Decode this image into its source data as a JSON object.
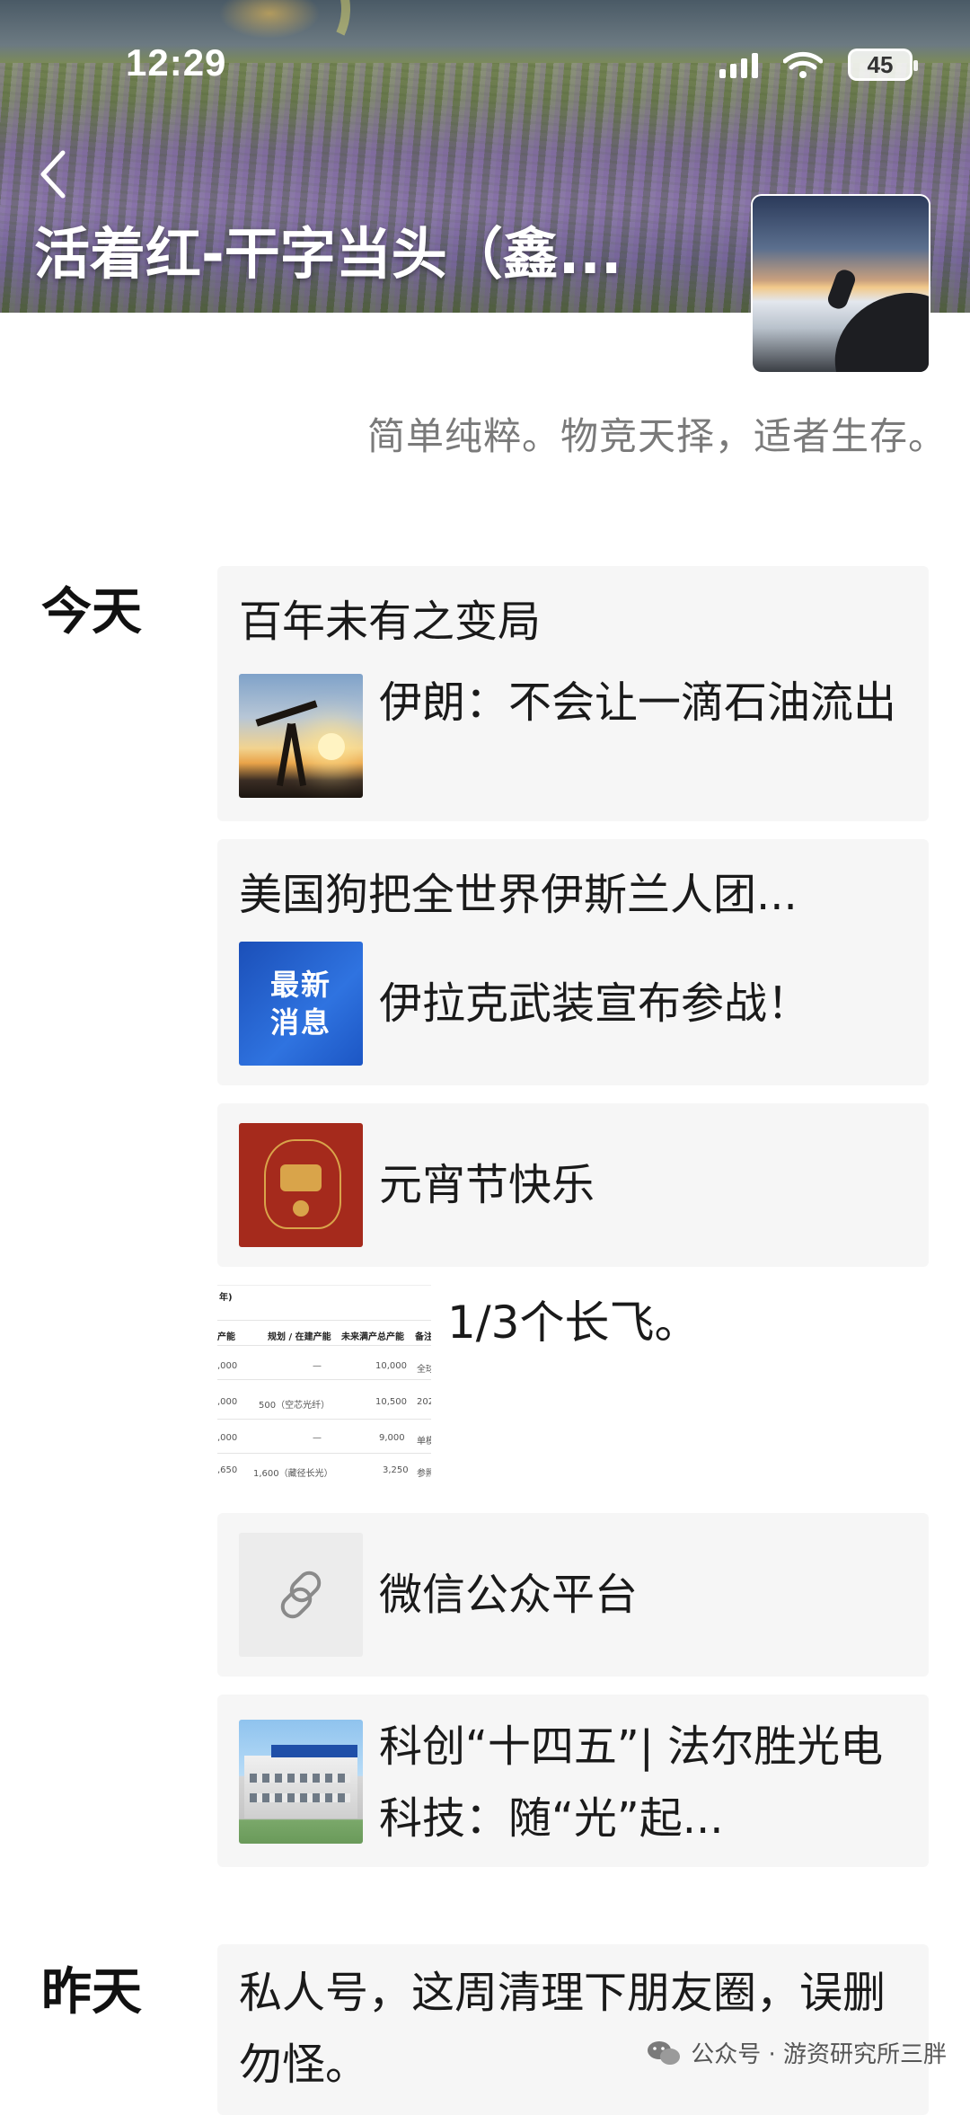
{
  "status_bar": {
    "time": "12:29",
    "battery": "45"
  },
  "header": {
    "account_name": "活着红-干字当头（鑫...",
    "slogan": "简单纯粹。物竞天择，适者生存。"
  },
  "timeline": [
    {
      "day": "今天",
      "posts": [
        {
          "title": "百年未有之变局",
          "sub": "伊朗：不会让一滴石油流出",
          "thumb_icon": "oil-pump-sunset-image"
        },
        {
          "title": "美国狗把全世界伊斯兰人团...",
          "sub": "伊拉克武装宣布参战！",
          "thumb_icon": "latest-news-badge",
          "thumb_text": [
            "最新",
            "消息"
          ]
        },
        {
          "sub": "元宵节快乐",
          "thumb_icon": "red-festival-image"
        },
        {
          "sub": "1/3个长飞。",
          "thumb_icon": "table-screenshot",
          "table": {
            "title": "年)",
            "headers": [
              "产能",
              "规划 / 在建产能",
              "未来满产总产能",
              "备注"
            ],
            "rows": [
              [
                ",000",
                "—",
                "10,000",
                "全球"
              ],
              [
                ",000",
                "500（空芯光纤）",
                "10,500",
                "202"
              ],
              [
                ",000",
                "—",
                "9,000",
                "单模"
              ],
              [
                ",650",
                "1,600（藏径长光）",
                "3,250",
                "参照"
              ]
            ]
          }
        },
        {
          "sub": "微信公众平台",
          "thumb_icon": "link-icon"
        },
        {
          "sub": "科创“十四五”| 法尔胜光电科技：随“光”起...",
          "thumb_icon": "factory-building-image"
        }
      ]
    },
    {
      "day": "昨天",
      "posts": [
        {
          "sub": "私人号，这周清理下朋友圈，误删勿怪。"
        }
      ]
    }
  ],
  "watermark": {
    "text": "公众号 · 游资研究所三胖"
  },
  "colors": {
    "card_bg": "#f6f6f6",
    "slogan": "#7a7a7a",
    "news_blue": "#1b4fb8",
    "festival_red": "#a52a1c"
  }
}
